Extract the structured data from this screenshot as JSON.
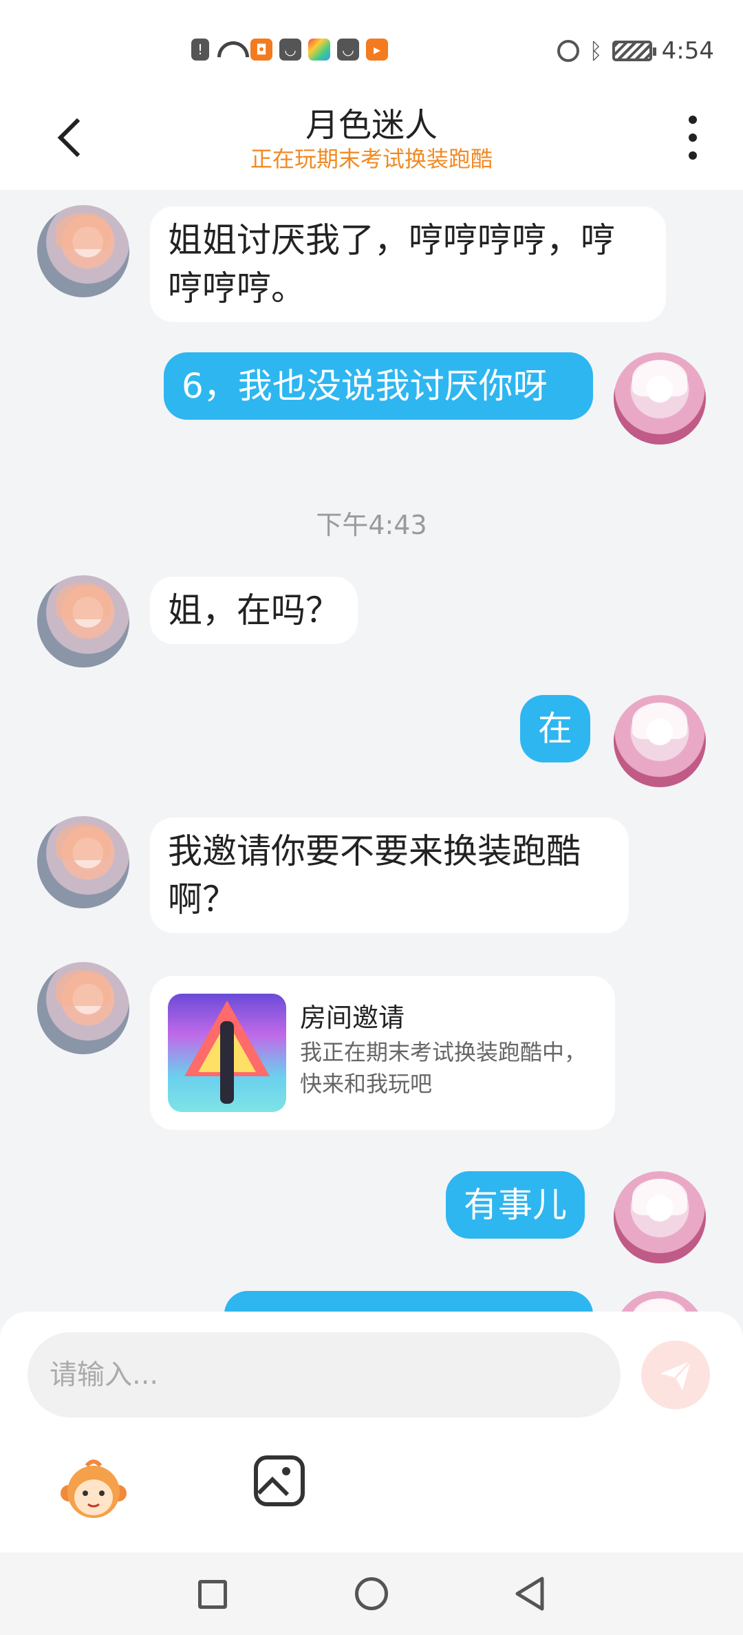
{
  "status_bar": {
    "time": "4:54",
    "left_icons": [
      "alert-icon",
      "wifi-icon",
      "app-orange-icon",
      "bag-icon",
      "app-rainbow-icon",
      "bag-icon",
      "play-icon"
    ],
    "right_icons": [
      "alarm-icon",
      "bluetooth-icon",
      "battery-icon"
    ]
  },
  "header": {
    "title": "月色迷人",
    "subtitle": "正在玩期末考试换装跑酷",
    "subtitle_color": "#f08a24"
  },
  "messages": [
    {
      "side": "left",
      "text": "姐姐讨厌我了，哼哼哼哼，哼哼哼哼。"
    },
    {
      "side": "right",
      "text": "6，我也没说我讨厌你呀"
    },
    {
      "type": "timestamp",
      "text": "下午4:43"
    },
    {
      "side": "left",
      "text": "姐，在吗？"
    },
    {
      "side": "right",
      "text": "在"
    },
    {
      "side": "left",
      "text": "我邀请你要不要来换装跑酷啊？"
    },
    {
      "side": "left",
      "type": "card",
      "title": "房间邀请",
      "desc": "我正在期末考试换装跑酷中，快来和我玩吧"
    },
    {
      "side": "right",
      "text": "有事儿"
    }
  ],
  "input": {
    "placeholder": "请输入..."
  },
  "colors": {
    "my_bubble": "#2eb6f0",
    "friend_bubble": "#ffffff",
    "send_button": "#fde3e0"
  }
}
